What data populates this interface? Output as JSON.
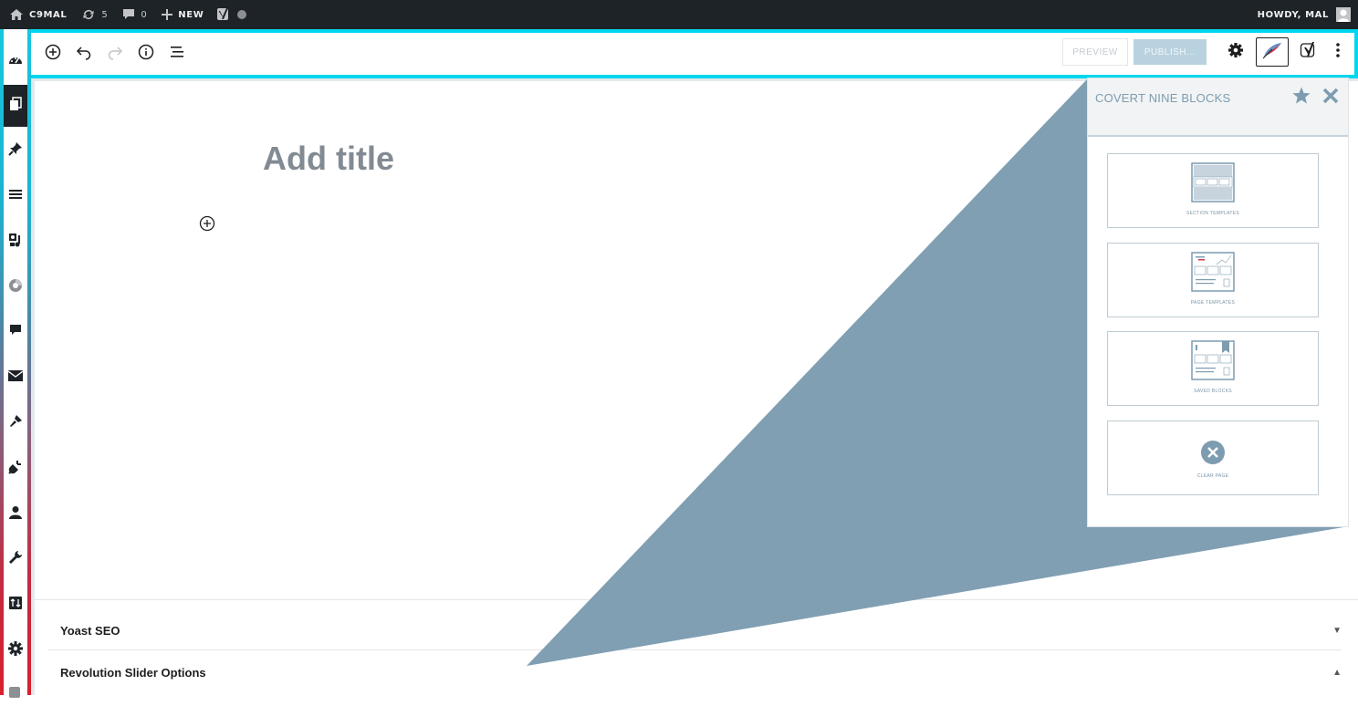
{
  "admin_bar": {
    "site_name": "C9MAL",
    "updates_count": "5",
    "comments_count": "0",
    "new_label": "NEW",
    "greeting": "HOWDY, MAL"
  },
  "left_menu": {
    "items": [
      "dashboard",
      "pages",
      "posts",
      "lists",
      "media",
      "revolution-slider",
      "comments",
      "mail",
      "appearance",
      "plugins",
      "users",
      "tools",
      "transfer",
      "settings",
      "yoast"
    ]
  },
  "editor_header": {
    "preview_label": "PREVIEW",
    "publish_label": "PUBLISH..."
  },
  "editor": {
    "title_placeholder": "Add title"
  },
  "metaboxes": [
    {
      "label": "Yoast SEO",
      "arrow": "▼"
    },
    {
      "label": "Revolution Slider Options",
      "arrow": "▲"
    }
  ],
  "blocks_panel": {
    "title": "COVERT NINE BLOCKS",
    "cards": [
      {
        "label": "SECTION TEMPLATES"
      },
      {
        "label": "PAGE TEMPLATES"
      },
      {
        "label": "SAVED BLOCKS"
      },
      {
        "label": "CLEAR PAGE"
      }
    ]
  },
  "colors": {
    "accent_cyan": "#00d7ee",
    "panel_blue": "#809fb3",
    "publish_bg": "#b9d2df",
    "admin_bar_bg": "#1d2327"
  }
}
